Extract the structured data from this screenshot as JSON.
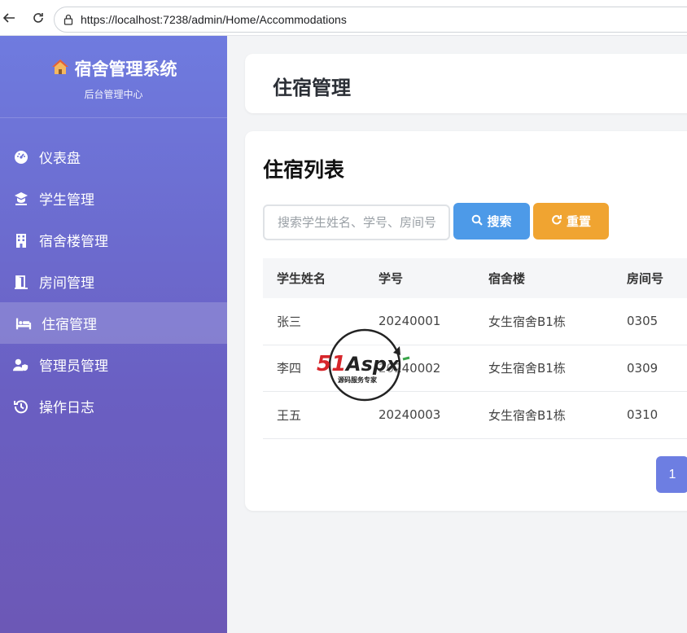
{
  "browser": {
    "url": "https://localhost:7238/admin/Home/Accommodations"
  },
  "sidebar": {
    "brand_icon": "house-icon",
    "brand_title": "宿舍管理系统",
    "brand_subtitle": "后台管理中心",
    "items": [
      {
        "label": "仪表盘",
        "icon": "dashboard-icon",
        "active": false
      },
      {
        "label": "学生管理",
        "icon": "graduate-icon",
        "active": false
      },
      {
        "label": "宿舍楼管理",
        "icon": "building-icon",
        "active": false
      },
      {
        "label": "房间管理",
        "icon": "door-icon",
        "active": false
      },
      {
        "label": "住宿管理",
        "icon": "bed-icon",
        "active": true
      },
      {
        "label": "管理员管理",
        "icon": "user-shield-icon",
        "active": false
      },
      {
        "label": "操作日志",
        "icon": "history-icon",
        "active": false
      }
    ]
  },
  "header": {
    "title": "住宿管理"
  },
  "list": {
    "title": "住宿列表",
    "search_placeholder": "搜索学生姓名、学号、房间号",
    "search_button": "搜索",
    "reset_button": "重置",
    "columns": [
      "学生姓名",
      "学号",
      "宿舍楼",
      "房间号"
    ],
    "rows": [
      [
        "张三",
        "20240001",
        "女生宿舍B1栋",
        "0305"
      ],
      [
        "李四",
        "20240002",
        "女生宿舍B1栋",
        "0309"
      ],
      [
        "王五",
        "20240003",
        "女生宿舍B1栋",
        "0310"
      ]
    ],
    "current_page": "1"
  },
  "watermark": {
    "text": "51Aspx",
    "subtext": "源码服务专家"
  },
  "colors": {
    "sidebar_top": "#6f7bdf",
    "sidebar_bottom": "#6c58b6",
    "search_button": "#4d9ae8",
    "reset_button": "#f0a431",
    "page_button": "#6d7ee2"
  }
}
